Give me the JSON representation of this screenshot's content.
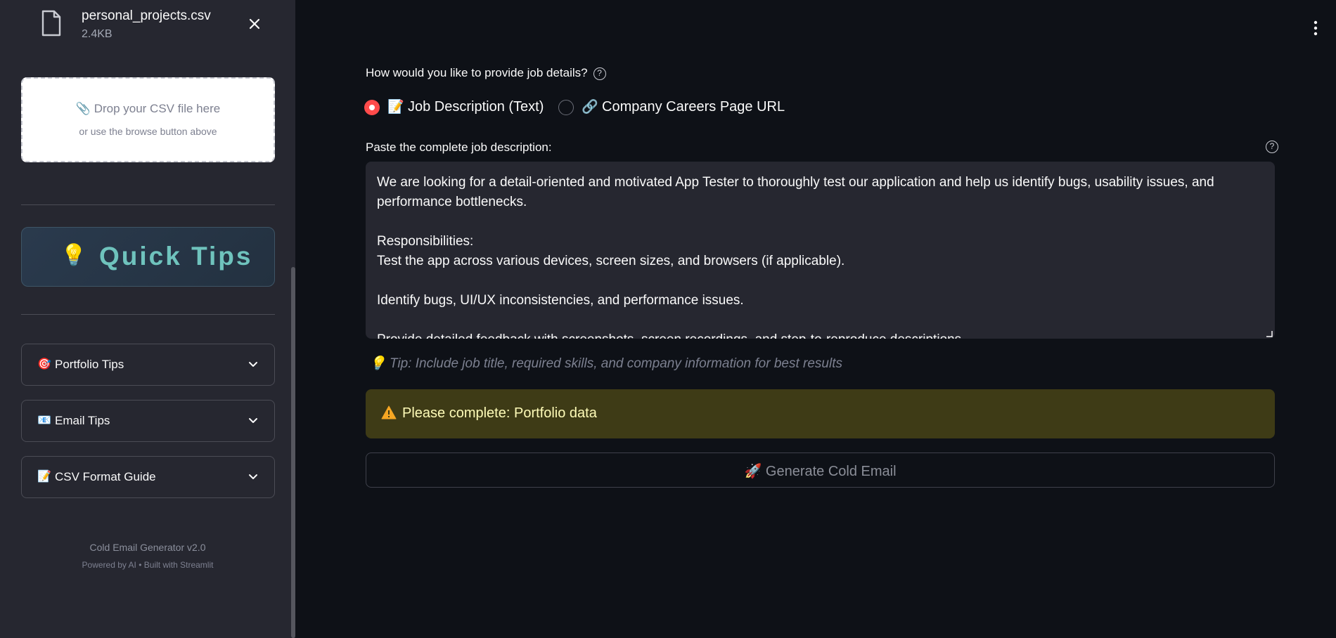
{
  "sidebar": {
    "file": {
      "name": "personal_projects.csv",
      "size": "2.4KB"
    },
    "dropzone": {
      "icon": "paperclip-icon",
      "title": "Drop your CSV file here",
      "subtitle": "or use the browse button above"
    },
    "quick_tips": {
      "icon": "💡",
      "label": "Quick Tips"
    },
    "expanders": [
      {
        "icon": "🎯",
        "label": "Portfolio Tips"
      },
      {
        "icon": "📧",
        "label": "Email Tips"
      },
      {
        "icon": "📝",
        "label": "CSV Format Guide"
      }
    ],
    "footer": {
      "title": "Cold Email Generator v2.0",
      "subtitle": "Powered by AI • Built with Streamlit"
    }
  },
  "main": {
    "question": {
      "label": "How would you like to provide job details?",
      "help": "?"
    },
    "radio": {
      "options": [
        {
          "icon": "📝",
          "label": "Job Description (Text)",
          "selected": true
        },
        {
          "icon": "🔗",
          "label": "Company Careers Page URL",
          "selected": false
        }
      ]
    },
    "job_description": {
      "label": "Paste the complete job description:",
      "help": "?",
      "value": "We are looking for a detail-oriented and motivated App Tester to thoroughly test our application and help us identify bugs, usability issues, and performance bottlenecks.\n\nResponsibilities:\nTest the app across various devices, screen sizes, and browsers (if applicable).\n\nIdentify bugs, UI/UX inconsistencies, and performance issues.\n\nProvide detailed feedback with screenshots, screen recordings, and step-to-reproduce descriptions."
    },
    "tip": {
      "icon": "💡",
      "text": "Tip: Include job title, required skills, and company information for best results"
    },
    "warning": {
      "icon": "warning-icon",
      "text": "Please complete: Portfolio data",
      "color": "#3e3b16"
    },
    "generate_button": {
      "icon": "🚀",
      "label": "Generate Cold Email"
    }
  },
  "colors": {
    "accent": "#ff4b4b",
    "sidebar_bg": "#262730",
    "app_bg": "#0e1117",
    "quick_tips_text": "#6fc3bd"
  }
}
